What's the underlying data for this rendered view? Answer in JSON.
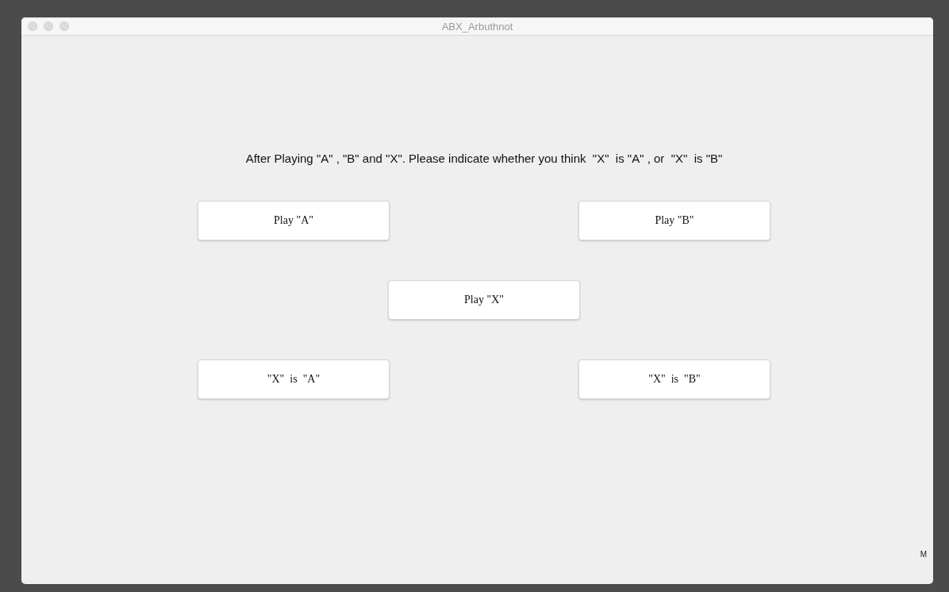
{
  "window": {
    "title": "ABX_Arbuthnot"
  },
  "instruction": "After Playing \"A\" , \"B\" and \"X\". Please indicate whether you think  \"X\"  is \"A\" , or  \"X\"  is \"B\"",
  "buttons": [
    {
      "label": "Play \"A\"",
      "kind": "left"
    },
    {
      "label": "Play \"B\"",
      "kind": "right"
    },
    {
      "label": "Play \"X\"",
      "kind": "center"
    },
    {
      "label": "\"X\"  is  \"A\"",
      "kind": "left"
    },
    {
      "label": "\"X\"  is  \"B\"",
      "kind": "right"
    }
  ],
  "corner_label": "M"
}
